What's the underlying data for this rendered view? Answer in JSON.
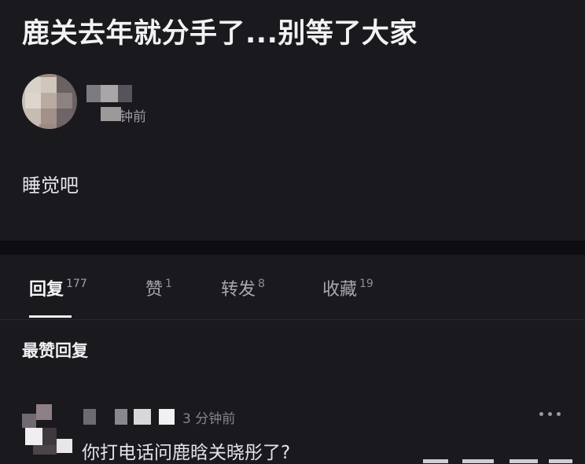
{
  "post": {
    "title": "鹿关去年就分手了...别等了大家",
    "author_time": "钟前",
    "body": "睡觉吧"
  },
  "tabs": [
    {
      "label": "回复",
      "count": "177",
      "active": true
    },
    {
      "label": "赞",
      "count": "1",
      "active": false
    },
    {
      "label": "转发",
      "count": "8",
      "active": false
    },
    {
      "label": "收藏",
      "count": "19",
      "active": false
    }
  ],
  "section_heading": "最赞回复",
  "reply": {
    "time": "3 分钟前",
    "text": "你打电话问鹿晗关晓彤了?",
    "more_icon": "more-dots-icon"
  },
  "colors": {
    "background": "#1a191e",
    "divider": "#0e0d11",
    "active_tab": "#f4f4f6",
    "inactive_tab": "#a9a8ae"
  }
}
